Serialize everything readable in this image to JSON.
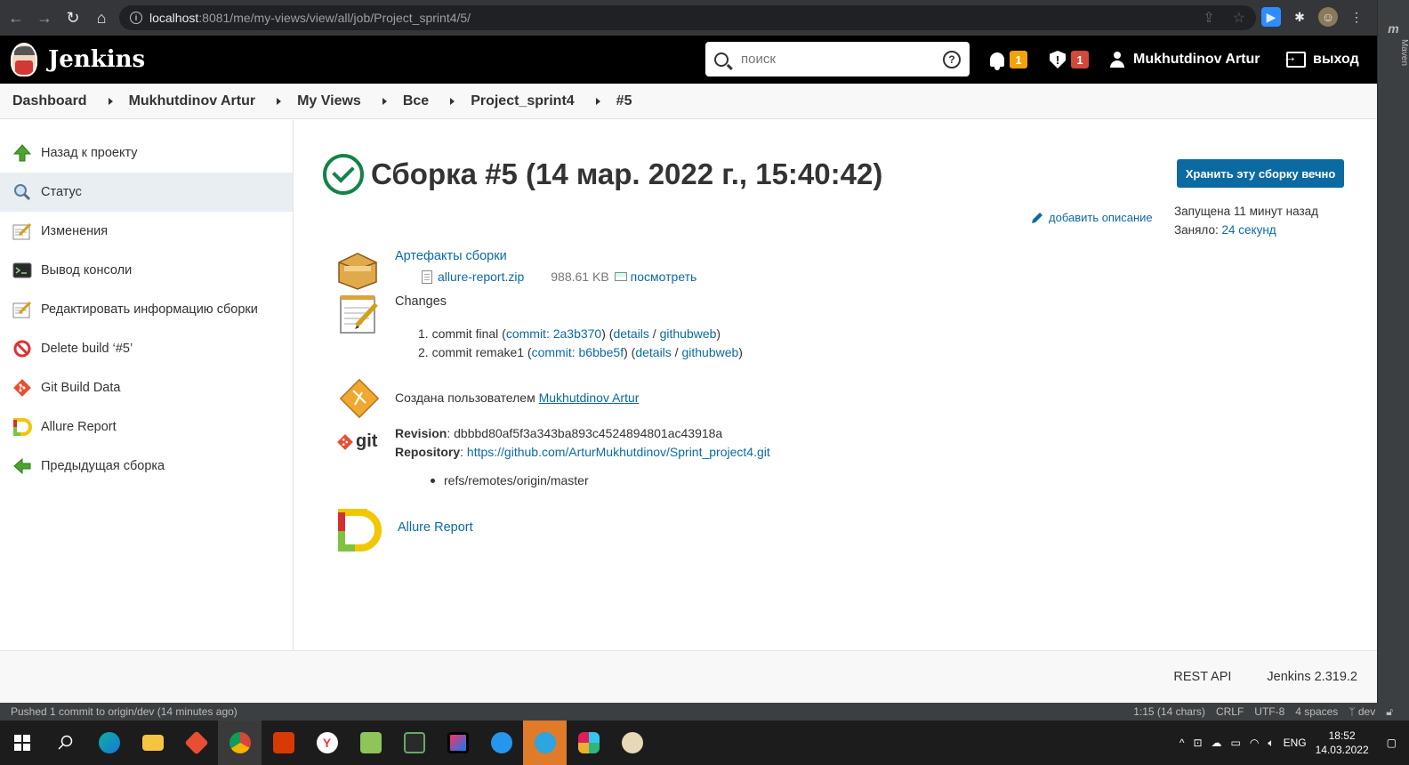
{
  "browser": {
    "url_host": "localhost",
    "url_path": ":8081/me/my-views/view/all/job/Project_sprint4/5/"
  },
  "ide": {
    "maven_label": "Maven",
    "status_left": "Pushed 1 commit to origin/dev (14 minutes ago)",
    "status_right": [
      "1:15 (14 chars)",
      "CRLF",
      "UTF-8",
      "4 spaces",
      "dev"
    ]
  },
  "header": {
    "logo": "Jenkins",
    "search_placeholder": "поиск",
    "notifications_count": "1",
    "security_count": "1",
    "user": "Mukhutdinov Artur",
    "logout": "выход"
  },
  "breadcrumb": [
    "Dashboard",
    "Mukhutdinov Artur",
    "My Views",
    "Все",
    "Project_sprint4",
    "#5"
  ],
  "sidebar": {
    "items": [
      {
        "label": "Назад к проекту",
        "icon": "up-arrow-icon"
      },
      {
        "label": "Статус",
        "icon": "magnifier-icon"
      },
      {
        "label": "Изменения",
        "icon": "notepad-icon"
      },
      {
        "label": "Вывод консоли",
        "icon": "terminal-icon"
      },
      {
        "label": "Редактировать информацию сборки",
        "icon": "notepad-icon"
      },
      {
        "label": "Delete build ‘#5’",
        "icon": "no-entry-icon"
      },
      {
        "label": "Git Build Data",
        "icon": "git-icon"
      },
      {
        "label": "Allure Report",
        "icon": "allure-icon"
      },
      {
        "label": "Предыдущая сборка",
        "icon": "left-arrow-icon"
      }
    ]
  },
  "main": {
    "title": "Сборка #5 (14 мар. 2022 г., 15:40:42)",
    "keep_button": "Хранить эту сборку вечно",
    "add_description": "добавить описание",
    "started": "Запущена 11 минут назад",
    "took_label": "Заняло:",
    "took_value": "24 секунд",
    "artifacts_title": "Артефакты сборки",
    "artifact_name": "allure-report.zip",
    "artifact_size": "988.61 KB",
    "artifact_view": "посмотреть",
    "changes_title": "Changes",
    "changes": [
      {
        "num": "1.",
        "msg": "commit final",
        "commit": "commit: 2a3b370",
        "details": "details",
        "web": "githubweb"
      },
      {
        "num": "2.",
        "msg": "commit remake1",
        "commit": "commit: b6bbe5f",
        "details": "details",
        "web": "githubweb"
      }
    ],
    "created_by_label": "Создана пользователем",
    "created_by_user": "Mukhutdinov Artur",
    "git_logo": "git",
    "revision_label": "Revision",
    "revision_value": "dbbbd80af5f3a343ba893c4524894801ac43918a",
    "repository_label": "Repository",
    "repository_value": "https://github.com/ArturMukhutdinov/Sprint_project4.git",
    "ref": "refs/remotes/origin/master",
    "allure_link": "Allure Report"
  },
  "footer": {
    "rest_api": "REST API",
    "version": "Jenkins 2.319.2"
  },
  "taskbar": {
    "lang": "ENG",
    "time": "18:52",
    "date": "14.03.2022"
  },
  "colors": {
    "jenkins_blue": "#0b6aa2",
    "success_green": "#138347",
    "badge_orange": "#f0a30a",
    "badge_red": "#d24939"
  }
}
